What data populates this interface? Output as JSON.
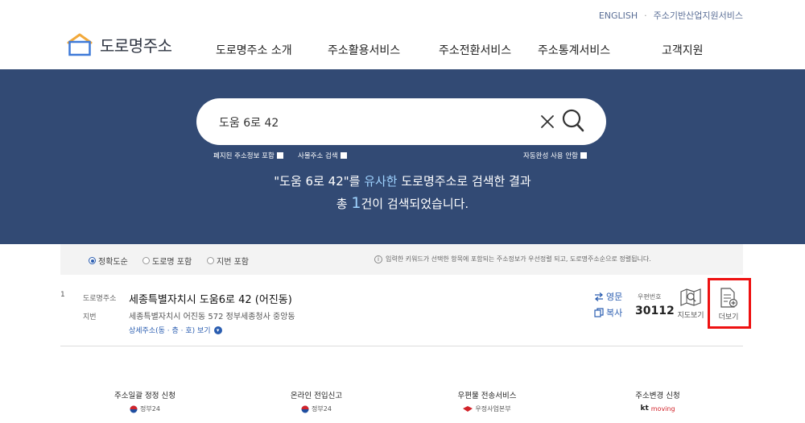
{
  "header": {
    "util_links": [
      "ENGLISH",
      "주소기반산업지원서비스"
    ],
    "logo_text": "도로명주소",
    "nav": [
      "도로명주소 소개",
      "주소활용서비스",
      "주소전환서비스",
      "주소통계서비스",
      "고객지원"
    ]
  },
  "search": {
    "query": "도움 6로 42",
    "options": {
      "abolished": "폐지된 주소정보 포함",
      "building": "사물주소 검색",
      "autocomplete": "자동완성 사용 안함"
    }
  },
  "result_message": {
    "q_open": "\"도움 6로 42\"를 ",
    "q_hl": "유사한",
    "q_close": " 도로명주소로 검색한 결과",
    "c_pre": "총 ",
    "c_num": "1",
    "c_post": "건이 검색되었습니다."
  },
  "filters": {
    "radios": [
      "정확도순",
      "도로명 포함",
      "지번 포함"
    ],
    "selected": "정확도순",
    "notice": "입력한 키워드가 선택한 항목에 포함되는 주소정보가 우선정렬 되고, 도로명주소순으로 정렬됩니다."
  },
  "result": {
    "number": "1",
    "road_label": "도로명주소",
    "road_address": "세종특별자치시 도움6로 42 (어진동)",
    "jibun_label": "지번",
    "jibun_address": "세종특별자치시 어진동 572 정부세종청사 중앙동",
    "detail_link": "상세주소(동 · 층 · 호) 보기",
    "english_link": "영문",
    "copy_link": "복사",
    "zip_label": "우편번호",
    "zip_code": "30112",
    "map_button": "지도보기",
    "more_button": "더보기"
  },
  "footer": [
    {
      "title": "주소일괄 정정 신청",
      "sub": "정부24"
    },
    {
      "title": "온라인 전입신고",
      "sub": "정부24"
    },
    {
      "title": "우편물 전송서비스",
      "sub": "우정사업본부"
    },
    {
      "title": "주소변경 신청",
      "sub": "moving"
    }
  ],
  "footer_extra": {
    "kt_prefix": "kt"
  },
  "colors": {
    "hero_bg": "#324a74",
    "accent": "#2a5db0",
    "highlight": "#ee1111"
  }
}
